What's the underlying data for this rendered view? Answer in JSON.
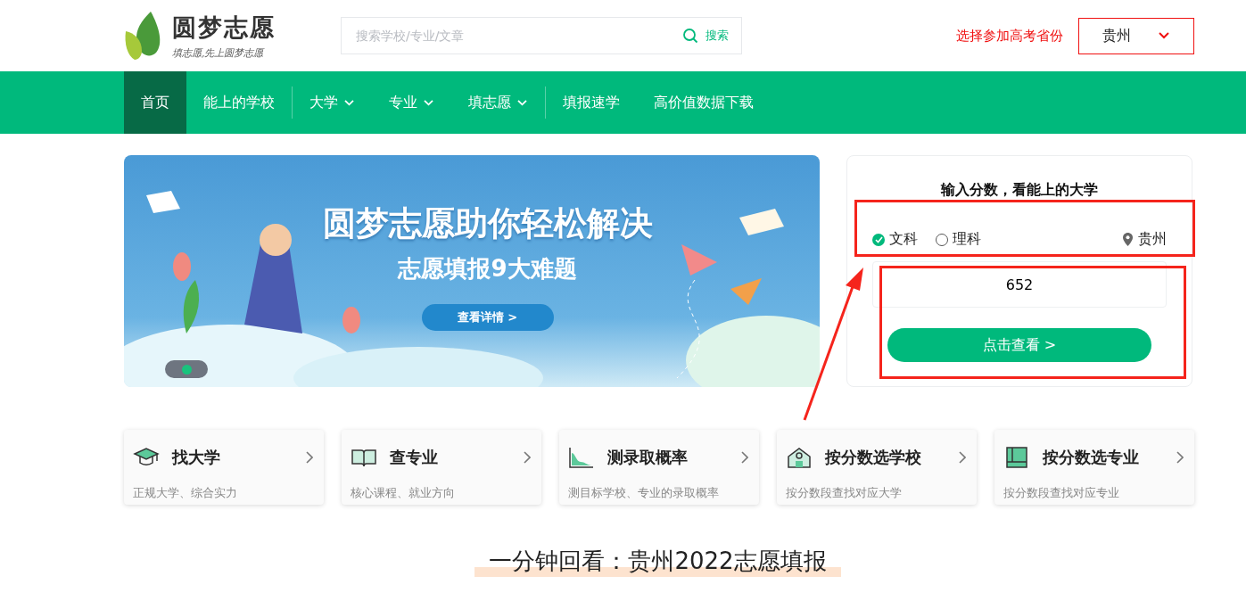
{
  "logo": {
    "name": "圆梦志愿",
    "slogan": "填志愿,先上圆梦志愿"
  },
  "search": {
    "placeholder": "搜索学校/专业/文章",
    "button": "搜索"
  },
  "province_prompt": "选择参加高考省份",
  "province_select": "贵州",
  "nav": [
    {
      "label": "首页",
      "selected": true,
      "dropdown": false,
      "divider_after": false
    },
    {
      "label": "能上的学校",
      "selected": false,
      "dropdown": false,
      "divider_after": true
    },
    {
      "label": "大学",
      "selected": false,
      "dropdown": true,
      "divider_after": false
    },
    {
      "label": "专业",
      "selected": false,
      "dropdown": true,
      "divider_after": false
    },
    {
      "label": "填志愿",
      "selected": false,
      "dropdown": true,
      "divider_after": true
    },
    {
      "label": "填报速学",
      "selected": false,
      "dropdown": false,
      "divider_after": false
    },
    {
      "label": "高价值数据下载",
      "selected": false,
      "dropdown": false,
      "divider_after": false
    }
  ],
  "banner": {
    "headline": "圆梦志愿助你轻松解决",
    "subline": "志愿填报9大难题",
    "button": "查看详情 >",
    "dots": [
      {
        "selected": true
      }
    ]
  },
  "score_card": {
    "title": "输入分数，看能上的大学",
    "tracks": [
      {
        "label": "文科",
        "selected": true
      },
      {
        "label": "理科",
        "selected": false
      }
    ],
    "province": "贵州",
    "score": "652",
    "submit": "点击查看 >"
  },
  "features": [
    {
      "kind": "cap",
      "title": "找大学",
      "subtitle": "正规大学、综合实力"
    },
    {
      "kind": "book",
      "title": "查专业",
      "subtitle": "核心课程、就业方向"
    },
    {
      "kind": "chart",
      "title": "测录取概率",
      "subtitle": "测目标学校、专业的录取概率"
    },
    {
      "kind": "school",
      "title": "按分数选学校",
      "subtitle": "按分数段查找对应大学"
    },
    {
      "kind": "ledger",
      "title": "按分数选专业",
      "subtitle": "按分数段查找对应专业"
    }
  ],
  "section_title": "一分钟回看：贵州2022志愿填报"
}
